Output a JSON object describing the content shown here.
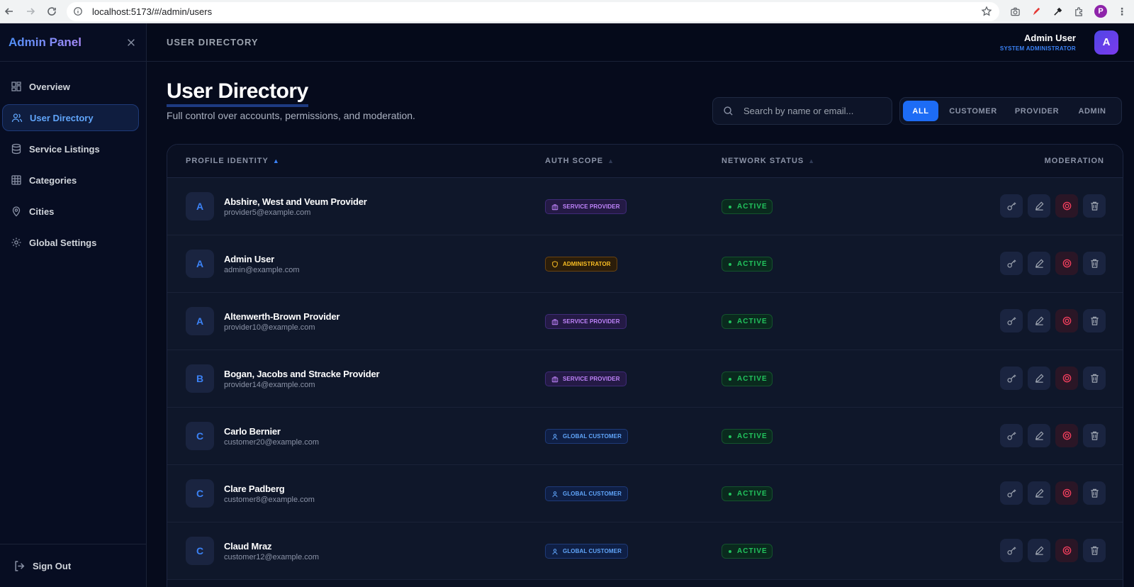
{
  "browser": {
    "url": "localhost:5173/#/admin/users",
    "profile_initial": "P"
  },
  "sidebar": {
    "brand": "Admin Panel",
    "items": [
      {
        "label": "Overview",
        "icon": "dashboard-icon"
      },
      {
        "label": "User Directory",
        "icon": "users-icon",
        "active": true
      },
      {
        "label": "Service Listings",
        "icon": "database-icon"
      },
      {
        "label": "Categories",
        "icon": "grid-icon"
      },
      {
        "label": "Cities",
        "icon": "map-pin-icon"
      },
      {
        "label": "Global Settings",
        "icon": "gear-icon"
      }
    ],
    "sign_out": "Sign Out"
  },
  "topbar": {
    "breadcrumb": "USER DIRECTORY",
    "user_name": "Admin User",
    "user_role": "SYSTEM ADMINISTRATOR",
    "avatar_initial": "A"
  },
  "main": {
    "title": "User Directory",
    "subtitle": "Full control over accounts, permissions, and moderation.",
    "search_placeholder": "Search by name or email...",
    "filters": [
      "ALL",
      "CUSTOMER",
      "PROVIDER",
      "ADMIN"
    ],
    "active_filter": "ALL"
  },
  "table": {
    "columns": [
      "PROFILE IDENTITY",
      "AUTH SCOPE",
      "NETWORK STATUS",
      "MODERATION"
    ],
    "rows": [
      {
        "initial": "A",
        "name": "Abshire, West and Veum Provider",
        "email": "provider5@example.com",
        "scope": "SERVICE PROVIDER",
        "scope_type": "provider",
        "status": "ACTIVE"
      },
      {
        "initial": "A",
        "name": "Admin User",
        "email": "admin@example.com",
        "scope": "ADMINISTRATOR",
        "scope_type": "admin",
        "status": "ACTIVE"
      },
      {
        "initial": "A",
        "name": "Altenwerth-Brown Provider",
        "email": "provider10@example.com",
        "scope": "SERVICE PROVIDER",
        "scope_type": "provider",
        "status": "ACTIVE"
      },
      {
        "initial": "B",
        "name": "Bogan, Jacobs and Stracke Provider",
        "email": "provider14@example.com",
        "scope": "SERVICE PROVIDER",
        "scope_type": "provider",
        "status": "ACTIVE"
      },
      {
        "initial": "C",
        "name": "Carlo Bernier",
        "email": "customer20@example.com",
        "scope": "GLOBAL CUSTOMER",
        "scope_type": "customer",
        "status": "ACTIVE"
      },
      {
        "initial": "C",
        "name": "Clare Padberg",
        "email": "customer8@example.com",
        "scope": "GLOBAL CUSTOMER",
        "scope_type": "customer",
        "status": "ACTIVE"
      },
      {
        "initial": "C",
        "name": "Claud Mraz",
        "email": "customer12@example.com",
        "scope": "GLOBAL CUSTOMER",
        "scope_type": "customer",
        "status": "ACTIVE"
      }
    ]
  },
  "colors": {
    "accent": "#1d6cf5",
    "active_status": "#22c55e",
    "provider": "#c084fc",
    "admin": "#fbbf24",
    "customer": "#60a5fa",
    "danger": "#f43f5e"
  }
}
